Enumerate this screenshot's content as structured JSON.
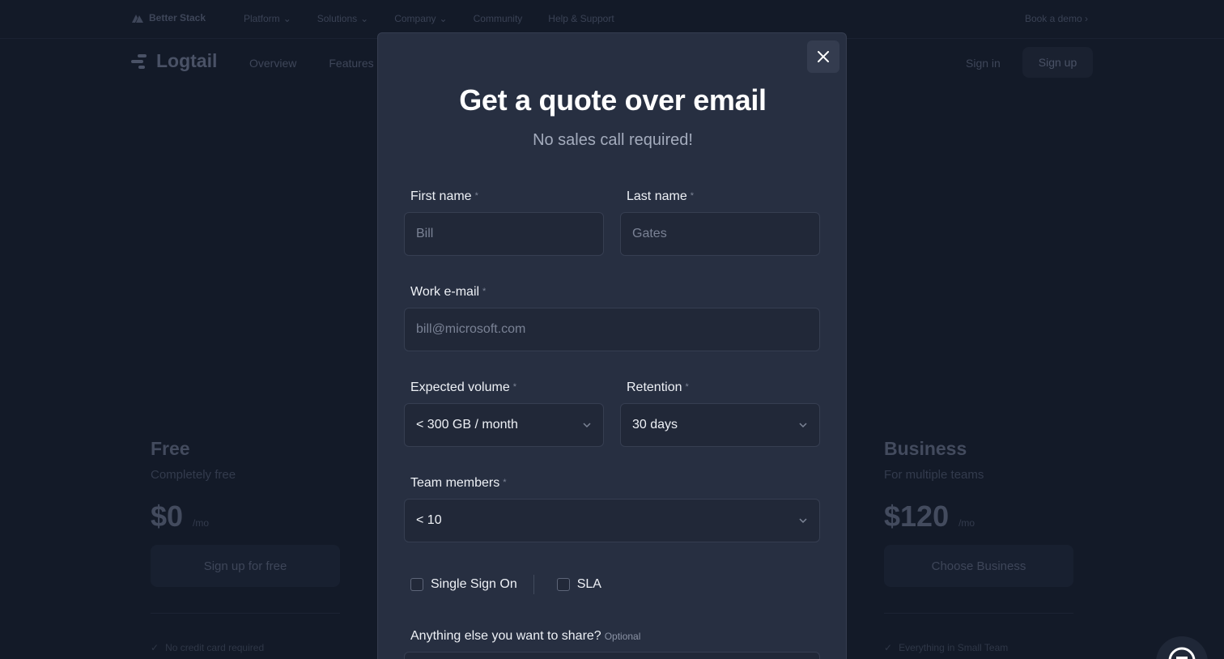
{
  "background": {
    "topbar": {
      "brand": "Better Stack",
      "nav": [
        "Platform",
        "Solutions",
        "Company",
        "Community",
        "Help & Support"
      ],
      "nav_dropdown_count": 3,
      "book_demo": "Book a demo"
    },
    "subbar": {
      "logo": "Logtail",
      "nav": [
        "Overview",
        "Features"
      ],
      "sign_in": "Sign in",
      "sign_up": "Sign up"
    },
    "plans": [
      {
        "name": "Free",
        "subtitle": "Completely free",
        "price": "$0",
        "period": "/mo",
        "cta": "Sign up for free",
        "first_feature": "No credit card required"
      },
      {
        "name": "Business",
        "subtitle": "For multiple teams",
        "price": "$120",
        "period": "/mo",
        "cta": "Choose Business",
        "first_feature": "Everything in Small Team"
      }
    ]
  },
  "modal": {
    "title": "Get a quote over email",
    "tagline": "No sales call required!",
    "required_mark": "*",
    "fields": {
      "first_name": {
        "label": "First name",
        "placeholder": "Bill"
      },
      "last_name": {
        "label": "Last name",
        "placeholder": "Gates"
      },
      "work_email": {
        "label": "Work e-mail",
        "placeholder": "bill@microsoft.com"
      },
      "expected_volume": {
        "label": "Expected volume",
        "value": "< 300 GB / month"
      },
      "retention": {
        "label": "Retention",
        "value": "30 days"
      },
      "team_members": {
        "label": "Team members",
        "value": "< 10"
      },
      "anything_else": {
        "label": "Anything else you want to share?",
        "optional": "Optional"
      }
    },
    "checkboxes": [
      {
        "label": "Single Sign On",
        "checked": false
      },
      {
        "label": "SLA",
        "checked": false
      }
    ]
  }
}
